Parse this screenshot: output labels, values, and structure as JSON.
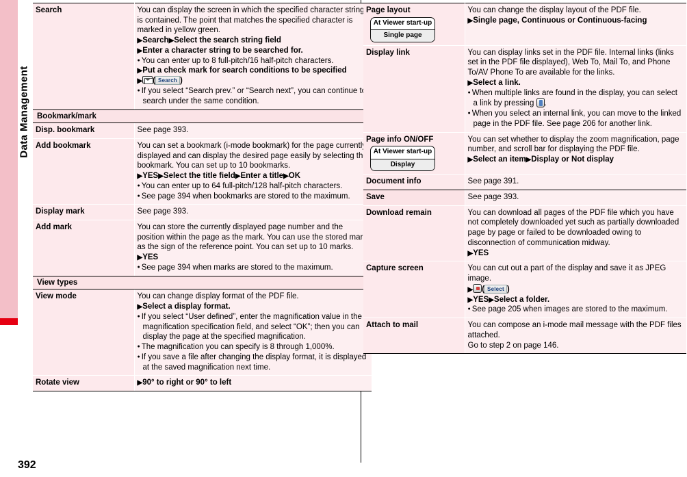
{
  "side_tab": {
    "label": "Data Management"
  },
  "page_number": "392",
  "left_column": {
    "rows": [
      {
        "kind": "entry",
        "term": "Search",
        "lines": [
          {
            "t": "text",
            "v": "You can display the screen in which the specified character string is contained. The point that matches the specified character is marked in yellow green."
          },
          {
            "t": "arrow_bold",
            "v": "Search▶Select the search string field"
          },
          {
            "t": "arrow_bold",
            "v": "Enter a character string to be searched for."
          },
          {
            "t": "bullet",
            "v": "You can enter up to 8 full-pitch/16 half-pitch characters."
          },
          {
            "t": "arrow_bold",
            "v": "Put a check mark for search conditions to be specified"
          },
          {
            "t": "arrow_key_mail",
            "v": "Search"
          },
          {
            "t": "bullet",
            "v": "If you select “Search prev.” or “Search next”, you can continue to search under the same condition."
          }
        ]
      },
      {
        "kind": "section",
        "label": "Bookmark/mark"
      },
      {
        "kind": "entry",
        "term": "Disp. bookmark",
        "lines": [
          {
            "t": "text",
            "v": "See page 393."
          }
        ]
      },
      {
        "kind": "entry",
        "term": "Add bookmark",
        "lines": [
          {
            "t": "text",
            "v": "You can set a bookmark (i-mode bookmark) for the page currently displayed and can display the desired page easily by selecting the bookmark. You can set up to 10 bookmarks."
          },
          {
            "t": "arrow_bold",
            "v": "YES▶Select the title field▶Enter a title▶OK"
          },
          {
            "t": "bullet",
            "v": "You can enter up to 64 full-pitch/128 half-pitch characters."
          },
          {
            "t": "bullet",
            "v": "See page 394 when bookmarks are stored to the maximum."
          }
        ]
      },
      {
        "kind": "entry",
        "term": "Display mark",
        "lines": [
          {
            "t": "text",
            "v": "See page 393."
          }
        ]
      },
      {
        "kind": "entry",
        "term": "Add mark",
        "lines": [
          {
            "t": "text",
            "v": "You can store the currently displayed page number and the position within the page as the mark. You can use the stored mark as the sign of the reference point. You can set up to 10 marks."
          },
          {
            "t": "arrow_bold",
            "v": "YES"
          },
          {
            "t": "bullet",
            "v": "See page 394 when marks are stored to the maximum."
          }
        ]
      },
      {
        "kind": "section",
        "label": "View types"
      },
      {
        "kind": "entry",
        "term": "View mode",
        "lines": [
          {
            "t": "text",
            "v": "You can change display format of the PDF file."
          },
          {
            "t": "arrow_bold",
            "v": "Select a display format."
          },
          {
            "t": "bullet",
            "v": "If you select “User defined”, enter the magnification value in the magnification specification field, and select “OK”; then you can display the page at the specified magnification."
          },
          {
            "t": "bullet",
            "v": "The magnification you can specify is 8 through 1,000%."
          },
          {
            "t": "bullet",
            "v": "If you save a file after changing the display format, it is displayed at the saved magnification next time."
          }
        ]
      },
      {
        "kind": "entry",
        "term": "Rotate view",
        "lines": [
          {
            "t": "arrow_bold",
            "v": "90° to right or 90° to left"
          }
        ]
      }
    ]
  },
  "right_column": {
    "rows": [
      {
        "kind": "entry_phonebox",
        "term": "Page layout",
        "phonebox": {
          "top": "At Viewer start-up",
          "bottom": "Single page"
        },
        "lines": [
          {
            "t": "text",
            "v": "You can change the display layout of the PDF file."
          },
          {
            "t": "arrow_bold",
            "v": "Single page, Continuous or Continuous-facing"
          }
        ]
      },
      {
        "kind": "entry",
        "term": "Display link",
        "lines": [
          {
            "t": "text",
            "v": "You can display links set in the PDF file. Internal links (links set in the PDF file displayed), Web To, Mail To, and Phone To/AV Phone To are available for the links."
          },
          {
            "t": "arrow_bold",
            "v": "Select a link."
          },
          {
            "t": "bullet_key_nav",
            "v": "When multiple links are found in the display, you can select a link by pressing "
          },
          {
            "t": "bullet",
            "v": "When you select an internal link, you can move to the linked page in the PDF file. See page 206 for another link."
          }
        ]
      },
      {
        "kind": "entry_phonebox",
        "term": "Page info ON/OFF",
        "phonebox": {
          "top": "At Viewer start-up",
          "bottom": "Display"
        },
        "lines": [
          {
            "t": "text",
            "v": "You can set whether to display the zoom magnification, page number, and scroll bar for displaying the PDF file."
          },
          {
            "t": "arrow_bold",
            "v": "Select an item▶Display or Not display"
          }
        ]
      },
      {
        "kind": "entry",
        "term": "Document info",
        "lines": [
          {
            "t": "text",
            "v": "See page 391."
          }
        ]
      },
      {
        "kind": "section_entry",
        "term": "Save",
        "lines": [
          {
            "t": "text",
            "v": "See page 393."
          }
        ]
      },
      {
        "kind": "entry",
        "term": "Download remain",
        "lines": [
          {
            "t": "text",
            "v": "You can download all pages of the PDF file which you have not completely downloaded yet such as partially downloaded page by page or failed to be downloaded owing to disconnection of communication midway."
          },
          {
            "t": "arrow_bold",
            "v": "YES"
          }
        ]
      },
      {
        "kind": "entry",
        "term": "Capture screen",
        "lines": [
          {
            "t": "text",
            "v": "You can cut out a part of the display and save it as JPEG image."
          },
          {
            "t": "arrow_key_center",
            "v": "Select"
          },
          {
            "t": "arrow_bold_after",
            "v": "YES▶Select a folder."
          },
          {
            "t": "bullet",
            "v": "See page 205 when images are stored to the maximum."
          }
        ]
      },
      {
        "kind": "entry",
        "term": "Attach to mail",
        "lines": [
          {
            "t": "text",
            "v": "You can compose an i-mode mail message with the PDF files attached."
          },
          {
            "t": "text",
            "v": "Go to step 2 on page 146."
          }
        ]
      }
    ]
  }
}
